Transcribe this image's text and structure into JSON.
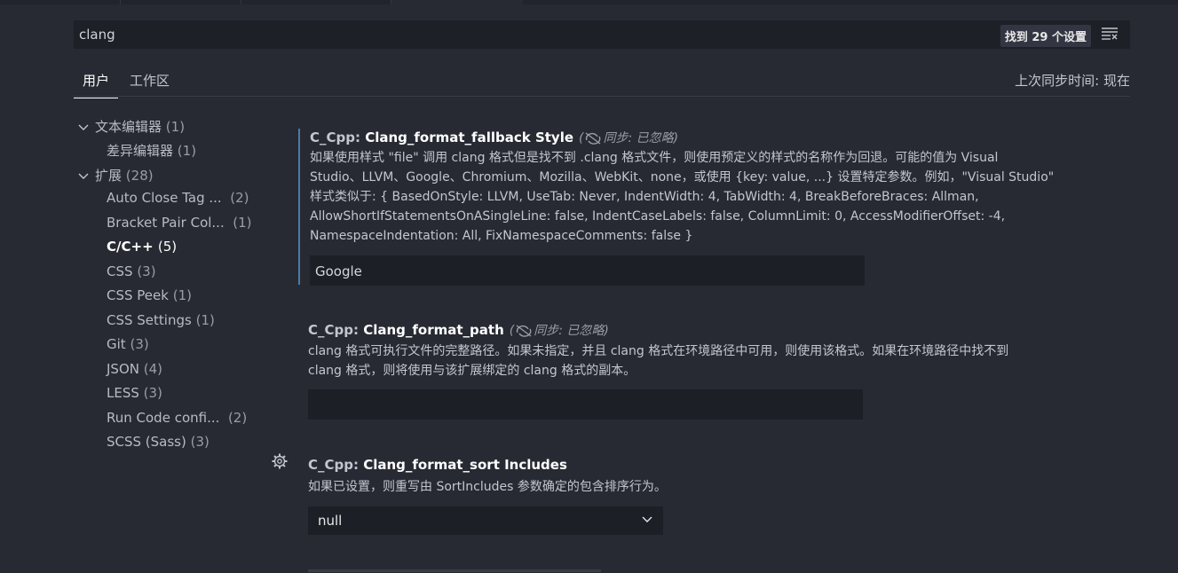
{
  "search": {
    "query": "clang",
    "count": "找到 29 个设置"
  },
  "tabs": [
    {
      "label": "用户"
    },
    {
      "label": "工作区"
    }
  ],
  "sync_status": "上次同步时间: 现在",
  "tree": {
    "text_editor": {
      "label": "文本编辑器",
      "count": "(1)"
    },
    "diff_editor": {
      "label": "差异编辑器",
      "count": "(1)"
    },
    "extensions": {
      "label": "扩展",
      "count": "(28)"
    },
    "items": [
      {
        "label": "Auto Close Tag ...",
        "count": "(2)"
      },
      {
        "label": "Bracket Pair Col...",
        "count": "(1)"
      },
      {
        "label": "C/C++",
        "count": "(5)"
      },
      {
        "label": "CSS",
        "count": "(3)"
      },
      {
        "label": "CSS Peek",
        "count": "(1)"
      },
      {
        "label": "CSS Settings",
        "count": "(1)"
      },
      {
        "label": "Git",
        "count": "(3)"
      },
      {
        "label": "JSON",
        "count": "(4)"
      },
      {
        "label": "LESS",
        "count": "(3)"
      },
      {
        "label": "Run Code confi...",
        "count": "(2)"
      },
      {
        "label": "SCSS (Sass)",
        "count": "(3)"
      }
    ]
  },
  "settings": [
    {
      "category": "C_Cpp: ",
      "key": "Clang_format_fallback Style",
      "sync_note": "同步: 已忽略)",
      "desc_lines": [
        "如果使用样式 \"file\" 调用 clang 格式但是找不到 .clang 格式文件，则使用预定义的样式的名称作为回退。可能的值为 Visual",
        "Studio、LLVM、Google、Chromium、Mozilla、WebKit、none，或使用 {key: value, ...} 设置特定参数。例如，\"Visual Studio\"",
        "样式类似于: { BasedOnStyle: LLVM, UseTab: Never, IndentWidth: 4, TabWidth: 4, BreakBeforeBraces: Allman,",
        "AllowShortIfStatementsOnASingleLine: false, IndentCaseLabels: false, ColumnLimit: 0, AccessModifierOffset: -4,",
        "NamespaceIndentation: All, FixNamespaceComments: false }"
      ],
      "value": "Google"
    },
    {
      "category": "C_Cpp: ",
      "key": "Clang_format_path",
      "sync_note": "同步: 已忽略)",
      "desc_lines": [
        "clang 格式可执行文件的完整路径。如果未指定，并且 clang 格式在环境路径中可用，则使用该格式。如果在环境路径中找不到",
        "clang 格式，则将使用与该扩展绑定的 clang 格式的副本。"
      ],
      "value": ""
    },
    {
      "category": "C_Cpp: ",
      "key": "Clang_format_sort Includes",
      "desc_lines": [
        "如果已设置，则重写由 SortIncludes 参数确定的包含排序行为。"
      ],
      "value": "null"
    }
  ],
  "colors": {
    "background": "#272a33",
    "input": "#1d1f26",
    "accent_bar": "#4d7aa8"
  }
}
